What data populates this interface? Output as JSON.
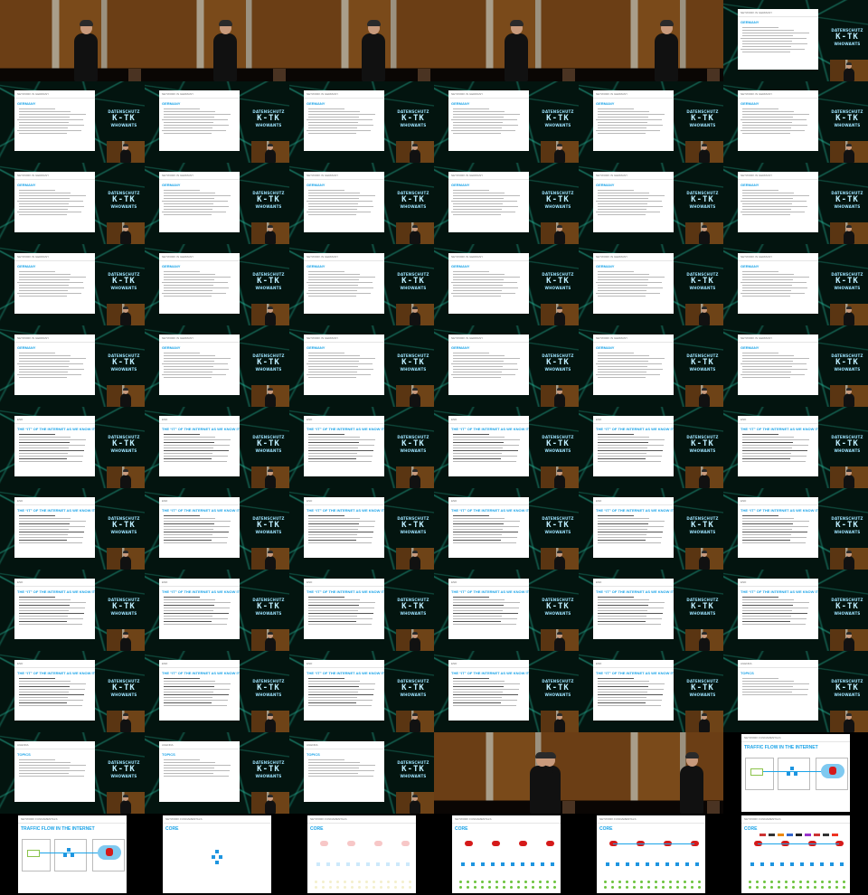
{
  "frames": [
    {
      "kind": "stage"
    },
    {
      "kind": "stage"
    },
    {
      "kind": "stage"
    },
    {
      "kind": "stage"
    },
    {
      "kind": "stage"
    },
    {
      "kind": "slide",
      "slide": "germany"
    },
    {
      "kind": "slide",
      "slide": "germany"
    },
    {
      "kind": "slide",
      "slide": "germany"
    },
    {
      "kind": "slide",
      "slide": "germany"
    },
    {
      "kind": "slide",
      "slide": "germany"
    },
    {
      "kind": "slide",
      "slide": "germany"
    },
    {
      "kind": "slide",
      "slide": "germany"
    },
    {
      "kind": "slide",
      "slide": "germany"
    },
    {
      "kind": "slide",
      "slide": "germany"
    },
    {
      "kind": "slide",
      "slide": "germany"
    },
    {
      "kind": "slide",
      "slide": "germany"
    },
    {
      "kind": "slide",
      "slide": "germany"
    },
    {
      "kind": "slide",
      "slide": "germany"
    },
    {
      "kind": "slide",
      "slide": "germany"
    },
    {
      "kind": "slide",
      "slide": "germany"
    },
    {
      "kind": "slide",
      "slide": "germany"
    },
    {
      "kind": "slide",
      "slide": "germany"
    },
    {
      "kind": "slide",
      "slide": "germany"
    },
    {
      "kind": "slide",
      "slide": "germany"
    },
    {
      "kind": "slide",
      "slide": "germany"
    },
    {
      "kind": "slide",
      "slide": "germany"
    },
    {
      "kind": "slide",
      "slide": "germany"
    },
    {
      "kind": "slide",
      "slide": "germany"
    },
    {
      "kind": "slide",
      "slide": "germany"
    },
    {
      "kind": "slide",
      "slide": "germany"
    },
    {
      "kind": "slide",
      "slide": "end"
    },
    {
      "kind": "slide",
      "slide": "end"
    },
    {
      "kind": "slide",
      "slide": "end"
    },
    {
      "kind": "slide",
      "slide": "end"
    },
    {
      "kind": "slide",
      "slide": "end"
    },
    {
      "kind": "slide",
      "slide": "end"
    },
    {
      "kind": "slide",
      "slide": "end"
    },
    {
      "kind": "slide",
      "slide": "end"
    },
    {
      "kind": "slide",
      "slide": "end"
    },
    {
      "kind": "slide",
      "slide": "end"
    },
    {
      "kind": "slide",
      "slide": "end"
    },
    {
      "kind": "slide",
      "slide": "end"
    },
    {
      "kind": "slide",
      "slide": "end"
    },
    {
      "kind": "slide",
      "slide": "end"
    },
    {
      "kind": "slide",
      "slide": "end"
    },
    {
      "kind": "slide",
      "slide": "end"
    },
    {
      "kind": "slide",
      "slide": "end"
    },
    {
      "kind": "slide",
      "slide": "end"
    },
    {
      "kind": "slide",
      "slide": "end"
    },
    {
      "kind": "slide",
      "slide": "end"
    },
    {
      "kind": "slide",
      "slide": "end"
    },
    {
      "kind": "slide",
      "slide": "end"
    },
    {
      "kind": "slide",
      "slide": "end"
    },
    {
      "kind": "slide",
      "slide": "topics"
    },
    {
      "kind": "slide",
      "slide": "topics"
    },
    {
      "kind": "slide",
      "slide": "topics"
    },
    {
      "kind": "slide",
      "slide": "topics"
    },
    {
      "kind": "stage"
    },
    {
      "kind": "stage"
    },
    {
      "kind": "full",
      "slide": "traffic"
    },
    {
      "kind": "full",
      "slide": "traffic"
    },
    {
      "kind": "full",
      "slide": "core_empty"
    },
    {
      "kind": "full",
      "slide": "core_pale"
    },
    {
      "kind": "full",
      "slide": "core_red"
    },
    {
      "kind": "full",
      "slide": "core_arrows"
    },
    {
      "kind": "full",
      "slide": "core_logos"
    }
  ],
  "slides": {
    "germany": {
      "header": "NETWORK IN GERMANY",
      "title": "GERMANY",
      "lines": 10
    },
    "end": {
      "header": "END",
      "title": "THE “IT” OF THE INTERNET AS WE KNOW IT TODAY",
      "lines": 11
    },
    "topics": {
      "header": "AGENDA",
      "title": "TOPICS",
      "lines": 7
    },
    "traffic": {
      "header": "NETWORK FUNDAMENTALS",
      "title": "TRAFFIC FLOW IN THE INTERNET"
    },
    "core_empty": {
      "header": "NETWORK FUNDAMENTALS",
      "title": "CORE"
    },
    "core_pale": {
      "header": "NETWORK FUNDAMENTALS",
      "title": "CORE"
    },
    "core_red": {
      "header": "NETWORK FUNDAMENTALS",
      "title": "CORE"
    },
    "core_arrows": {
      "header": "NETWORK FUNDAMENTALS",
      "title": "CORE"
    },
    "core_logos": {
      "header": "NETWORK FUNDAMENTALS",
      "title": "CORE"
    }
  },
  "logo": {
    "line1": "DATENSCHUTZ",
    "line2": "K-TK",
    "line3": "WHOWANTS"
  },
  "colors": {
    "accent": "#1aa3e8",
    "cloud": "#d51a1a",
    "node": "#1e95e0",
    "dot": "#6cc33c",
    "background": "#000000"
  }
}
